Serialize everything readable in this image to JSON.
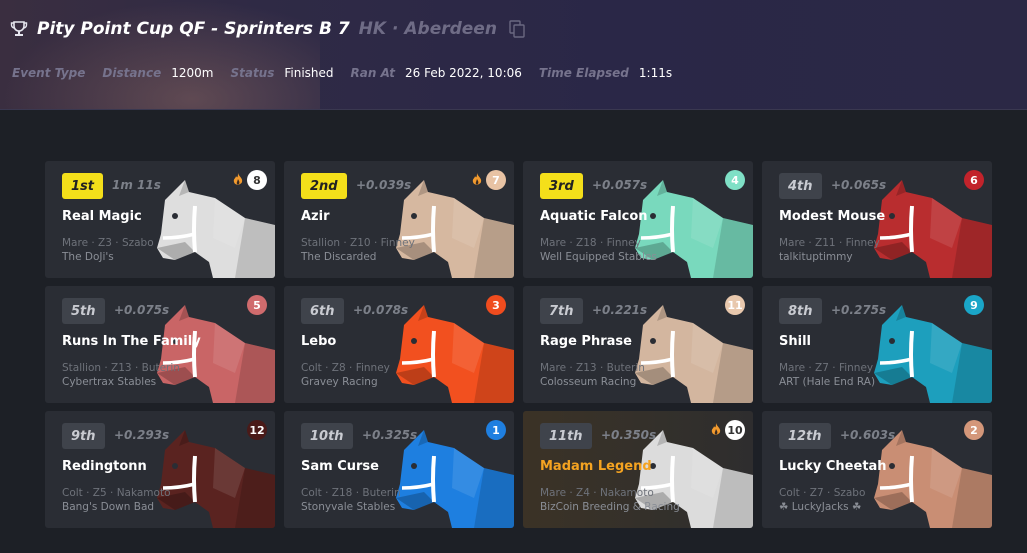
{
  "race": {
    "title": "Pity Point Cup QF - Sprinters B 7",
    "location": "HK · Aberdeen",
    "meta": [
      {
        "label": "Event Type",
        "value": ""
      },
      {
        "label": "Distance",
        "value": "1200m"
      },
      {
        "label": "Status",
        "value": "Finished"
      },
      {
        "label": "Ran At",
        "value": "26 Feb 2022, 10:06"
      },
      {
        "label": "Time Elapsed",
        "value": "1:11s"
      }
    ]
  },
  "results": [
    {
      "position": "1st",
      "margin": "1m 11s",
      "name": "Real Magic",
      "info": "Mare · Z3 · Szabo",
      "stable": "The DoJi's",
      "gate": "8",
      "gate_color": "#ffffff",
      "gate_text": "#333333",
      "horse_color": "#dedede",
      "hot": true,
      "podium": true,
      "highlight": false
    },
    {
      "position": "2nd",
      "margin": "+0.039s",
      "name": "Azir",
      "info": "Stallion · Z10 · Finney",
      "stable": "The Discarded",
      "stable_icon": "flame-icon",
      "gate": "7",
      "gate_color": "#e8c3a4",
      "gate_text": "#ffffff",
      "horse_color": "#d6b8a0",
      "hot": true,
      "podium": true,
      "highlight": false
    },
    {
      "position": "3rd",
      "margin": "+0.057s",
      "name": "Aquatic Falcon",
      "info": "Mare · Z18 · Finney",
      "stable": "Well Equipped Stables",
      "gate": "4",
      "gate_color": "#7fe0c6",
      "gate_text": "#ffffff",
      "horse_color": "#79d9bd",
      "hot": false,
      "podium": true,
      "highlight": false
    },
    {
      "position": "4th",
      "margin": "+0.065s",
      "name": "Modest Mouse",
      "info": "Mare · Z11 · Finney",
      "stable": "talkituptimmy",
      "gate": "6",
      "gate_color": "#c2232b",
      "gate_text": "#ffffff",
      "horse_color": "#b92d2f",
      "hot": false,
      "podium": false,
      "highlight": false
    },
    {
      "position": "5th",
      "margin": "+0.075s",
      "name": "Runs In The Family",
      "info": "Stallion · Z13 · Buterin",
      "stable": "Cybertrax Stables",
      "gate": "5",
      "gate_color": "#d06b6d",
      "gate_text": "#ffffff",
      "horse_color": "#c96566",
      "hot": false,
      "podium": false,
      "highlight": false
    },
    {
      "position": "6th",
      "margin": "+0.078s",
      "name": "Lebo",
      "info": "Colt · Z8 · Finney",
      "stable": "Gravey Racing",
      "gate": "3",
      "gate_color": "#f04c1e",
      "gate_text": "#ffffff",
      "horse_color": "#f2501f",
      "hot": false,
      "podium": false,
      "highlight": false
    },
    {
      "position": "7th",
      "margin": "+0.221s",
      "name": "Rage Phrase",
      "info": "Mare · Z13 · Buterin",
      "stable": "Colosseum Racing",
      "gate": "11",
      "gate_color": "#e8c8ad",
      "gate_text": "#ffffff",
      "horse_color": "#d3b69f",
      "hot": false,
      "podium": false,
      "highlight": false
    },
    {
      "position": "8th",
      "margin": "+0.275s",
      "name": "Shill",
      "info": "Mare · Z7 · Finney",
      "stable": "ART (Hale End RA)",
      "gate": "9",
      "gate_color": "#1aa6c8",
      "gate_text": "#ffffff",
      "horse_color": "#1d9fbd",
      "hot": false,
      "podium": false,
      "highlight": false
    },
    {
      "position": "9th",
      "margin": "+0.293s",
      "name": "Redingtonn",
      "info": "Colt · Z5 · Nakamoto",
      "stable": "Bang's Down Bad",
      "gate": "12",
      "gate_color": "#4a1a18",
      "gate_text": "#ffffff",
      "horse_color": "#5a2320",
      "hot": false,
      "podium": false,
      "highlight": false
    },
    {
      "position": "10th",
      "margin": "+0.325s",
      "name": "Sam Curse",
      "info": "Colt · Z18 · Buterin",
      "stable": "Stonyvale Stables",
      "gate": "1",
      "gate_color": "#1f7fe0",
      "gate_text": "#ffffff",
      "horse_color": "#1e7fe0",
      "hot": false,
      "podium": false,
      "highlight": false
    },
    {
      "position": "11th",
      "margin": "+0.350s",
      "name": "Madam Legend",
      "info": "Mare · Z4 · Nakamoto",
      "stable": "BizCoin Breeding & Racing",
      "gate": "10",
      "gate_color": "#ffffff",
      "gate_text": "#333333",
      "horse_color": "#dcdcdc",
      "hot": true,
      "podium": false,
      "highlight": true
    },
    {
      "position": "12th",
      "margin": "+0.603s",
      "name": "Lucky Cheetah",
      "info": "Colt · Z7 · Szabo",
      "stable": "☘ LuckyJacks ☘",
      "gate": "2",
      "gate_color": "#d4977a",
      "gate_text": "#ffffff",
      "horse_color": "#c98e74",
      "hot": false,
      "podium": false,
      "highlight": false
    }
  ]
}
